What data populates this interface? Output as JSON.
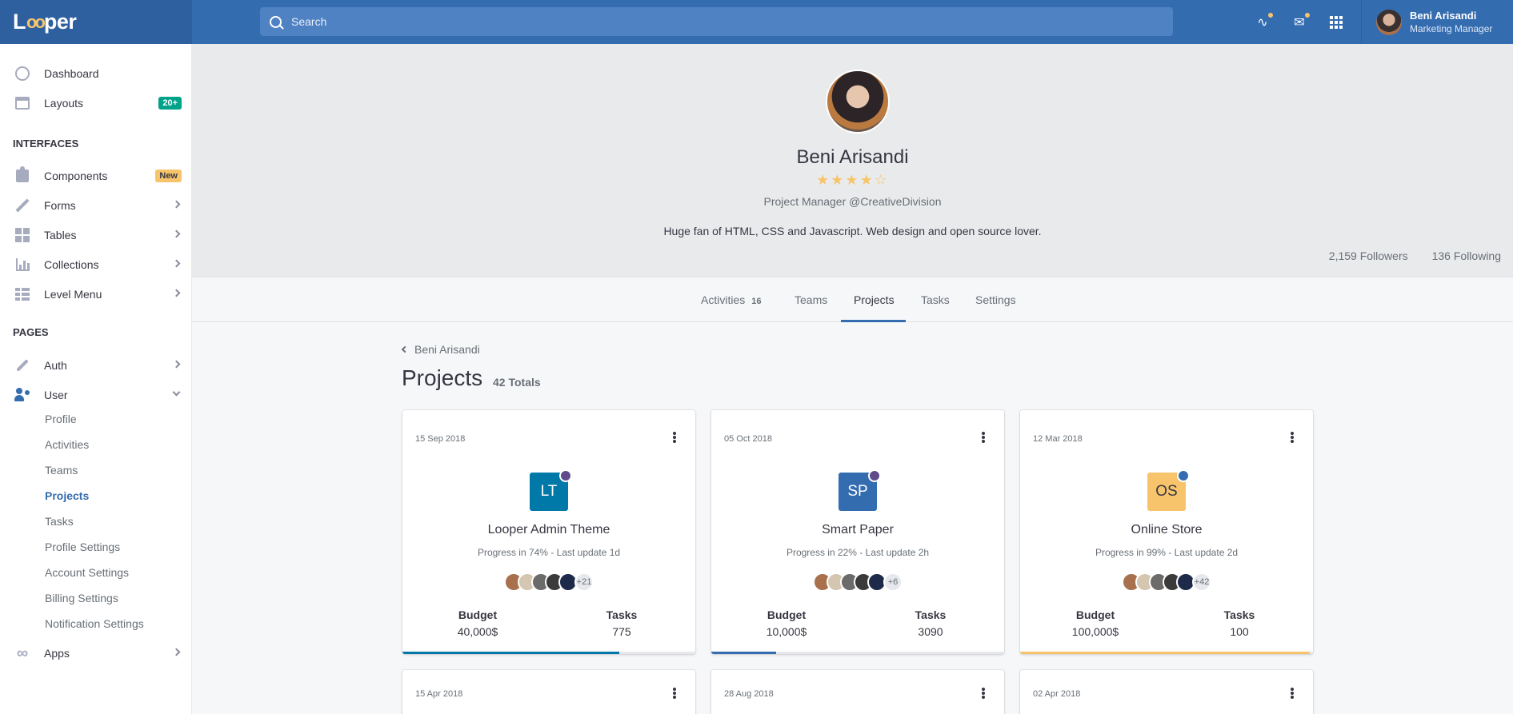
{
  "brand": {
    "name_prefix": "L",
    "name_oo": "oo",
    "name_suffix": "per"
  },
  "search": {
    "placeholder": "Search"
  },
  "header_user": {
    "name": "Beni Arisandi",
    "role": "Marketing Manager"
  },
  "sidebar": {
    "items": [
      {
        "label": "Dashboard"
      },
      {
        "label": "Layouts",
        "badge": "20+"
      }
    ],
    "interfaces_title": "INTERFACES",
    "interfaces": [
      {
        "label": "Components",
        "badge": "New"
      },
      {
        "label": "Forms"
      },
      {
        "label": "Tables"
      },
      {
        "label": "Collections"
      },
      {
        "label": "Level Menu"
      }
    ],
    "pages_title": "PAGES",
    "pages": [
      {
        "label": "Auth"
      },
      {
        "label": "User"
      }
    ],
    "user_sub": [
      "Profile",
      "Activities",
      "Teams",
      "Projects",
      "Tasks",
      "Profile Settings",
      "Account Settings",
      "Billing Settings",
      "Notification Settings"
    ],
    "apps": {
      "label": "Apps"
    }
  },
  "profile": {
    "name": "Beni Arisandi",
    "rating": 4,
    "rating_max": 5,
    "stars_text": "★★★★☆",
    "role": "Project Manager @CreativeDivision",
    "bio": "Huge fan of HTML, CSS and Javascript. Web design and open source lover.",
    "followers": "2,159 Followers",
    "following": "136 Following"
  },
  "tabs": [
    {
      "label": "Activities",
      "count": "16"
    },
    {
      "label": "Teams"
    },
    {
      "label": "Projects"
    },
    {
      "label": "Tasks"
    },
    {
      "label": "Settings"
    }
  ],
  "content": {
    "breadcrumb": "Beni Arisandi",
    "title": "Projects",
    "total": "42 Totals"
  },
  "labels": {
    "budget": "Budget",
    "tasks": "Tasks"
  },
  "colors": {
    "primary": "#346cb0",
    "teal": "#0179a8",
    "yellow": "#f7c46c",
    "purple": "#5f4b8b"
  },
  "projects": [
    {
      "date": "15 Sep 2018",
      "initials": "LT",
      "name": "Looper Admin Theme",
      "progress_text": "Progress in 74% - Last update 1d",
      "progress": 74,
      "more": "+21",
      "budget": "40,000$",
      "tasks": "775",
      "color": "#0179a8"
    },
    {
      "date": "05 Oct 2018",
      "initials": "SP",
      "name": "Smart Paper",
      "progress_text": "Progress in 22% - Last update 2h",
      "progress": 22,
      "more": "+6",
      "budget": "10,000$",
      "tasks": "3090",
      "color": "#346cb0"
    },
    {
      "date": "12 Mar 2018",
      "initials": "OS",
      "name": "Online Store",
      "progress_text": "Progress in 99% - Last update 2d",
      "progress": 99,
      "more": "+42",
      "budget": "100,000$",
      "tasks": "100",
      "color": "#f7c46c"
    }
  ],
  "projects_row2": [
    {
      "date": "15 Apr 2018"
    },
    {
      "date": "28 Aug 2018"
    },
    {
      "date": "02 Apr 2018"
    }
  ]
}
